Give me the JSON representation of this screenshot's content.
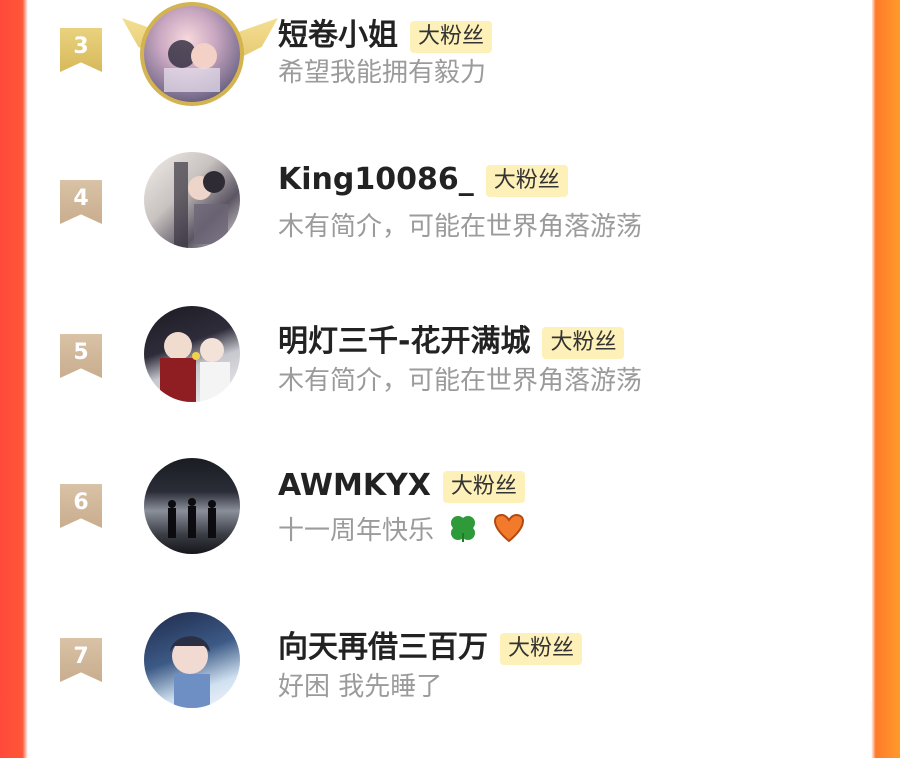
{
  "fans": [
    {
      "rank": "3",
      "name": "短卷小姐",
      "badge": "大粉丝",
      "bio": "希望我能拥有毅力"
    },
    {
      "rank": "4",
      "name": "King10086_",
      "badge": "大粉丝",
      "bio": "木有简介，可能在世界角落游荡"
    },
    {
      "rank": "5",
      "name": "明灯三千-花开满城",
      "badge": "大粉丝",
      "bio": "木有简介，可能在世界角落游荡"
    },
    {
      "rank": "6",
      "name": "AWMKYX",
      "badge": "大粉丝",
      "bio": "十一周年快乐",
      "bio_icons": [
        "clover-icon",
        "orange-heart-icon"
      ]
    },
    {
      "rank": "7",
      "name": "向天再借三百万",
      "badge": "大粉丝",
      "bio": "好困 我先睡了"
    }
  ],
  "colors": {
    "gold_rank": "#dcc163",
    "tan_rank": "#cdb291",
    "badge_bg": "#fdf0b8",
    "left_edge": "#ff4a3a",
    "right_edge": "#ff8a2a"
  }
}
